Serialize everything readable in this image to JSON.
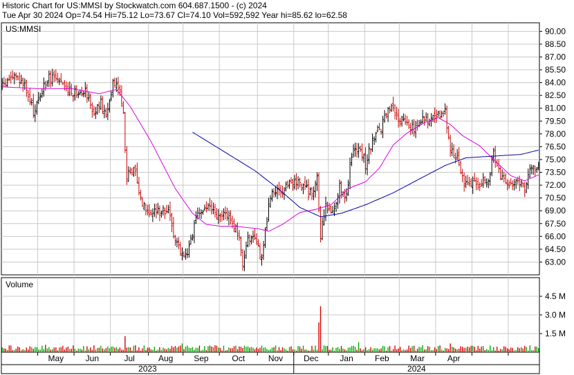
{
  "header": {
    "line1": "Historic Chart for US:MMSI by Stockwatch.com 604.687.1500 - (c) 2024",
    "line2": "Tue Apr 30 2024   Op=74.54   Hi=75.12   Lo=73.67   Cl=74.10   Vol=592,592   Year hi=85.62   lo=62.58"
  },
  "symbol_label": "US:MMSI",
  "volume_label": "Volume",
  "colors": {
    "background": "#ffffff",
    "grid": "#c8c8c8",
    "bar_up": "#000000",
    "bar_down": "#cc0000",
    "ma_short": "#dd00dd",
    "ma_long": "#0000aa",
    "volume_up": "#00aa00",
    "volume_down": "#dd0000"
  },
  "chart_data": [
    {
      "type": "ohlc",
      "title": "US:MMSI",
      "y_ticks": [
        "90.00",
        "88.50",
        "87.00",
        "85.50",
        "84.00",
        "82.50",
        "81.00",
        "79.50",
        "78.00",
        "76.50",
        "75.00",
        "73.50",
        "72.00",
        "70.50",
        "69.00",
        "67.50",
        "66.00",
        "64.50",
        "63.00"
      ],
      "ylim": [
        61.5,
        91.0
      ],
      "x_month_labels": [
        "May",
        "Jun",
        "Jul",
        "Aug",
        "Sep",
        "Oct",
        "Nov",
        "Dec",
        "Jan",
        "Feb",
        "Mar",
        "Apr"
      ],
      "x_year_labels": [
        "2023",
        "2024"
      ],
      "grid": true,
      "price_anchors": [
        {
          "d": 0,
          "c": 83.5
        },
        {
          "d": 6,
          "c": 84.8
        },
        {
          "d": 13,
          "c": 83.6
        },
        {
          "d": 18,
          "c": 80.5
        },
        {
          "d": 24,
          "c": 83.6
        },
        {
          "d": 29,
          "c": 84.9
        },
        {
          "d": 35,
          "c": 83.4
        },
        {
          "d": 42,
          "c": 82.9
        },
        {
          "d": 48,
          "c": 83.3
        },
        {
          "d": 53,
          "c": 80.4
        },
        {
          "d": 57,
          "c": 81.5
        },
        {
          "d": 60,
          "c": 79.8
        },
        {
          "d": 64,
          "c": 84.3
        },
        {
          "d": 68,
          "c": 83.4
        },
        {
          "d": 70,
          "c": 80.2
        },
        {
          "d": 72,
          "c": 72.8
        },
        {
          "d": 76,
          "c": 74.4
        },
        {
          "d": 80,
          "c": 70.4
        },
        {
          "d": 86,
          "c": 68.6
        },
        {
          "d": 93,
          "c": 69.3
        },
        {
          "d": 96,
          "c": 68.7
        },
        {
          "d": 101,
          "c": 65.1
        },
        {
          "d": 106,
          "c": 63.6
        },
        {
          "d": 109,
          "c": 65.9
        },
        {
          "d": 114,
          "c": 68.8
        },
        {
          "d": 119,
          "c": 69.6
        },
        {
          "d": 125,
          "c": 68.0
        },
        {
          "d": 130,
          "c": 68.8
        },
        {
          "d": 136,
          "c": 66.4
        },
        {
          "d": 139,
          "c": 63.1
        },
        {
          "d": 142,
          "c": 65.9
        },
        {
          "d": 147,
          "c": 65.1
        },
        {
          "d": 150,
          "c": 63.5
        },
        {
          "d": 152,
          "c": 66.9
        },
        {
          "d": 156,
          "c": 71.7
        },
        {
          "d": 162,
          "c": 70.5
        },
        {
          "d": 166,
          "c": 72.6
        },
        {
          "d": 172,
          "c": 72.3
        },
        {
          "d": 178,
          "c": 71.0
        },
        {
          "d": 182,
          "c": 72.5
        },
        {
          "d": 184,
          "c": 66.0
        },
        {
          "d": 187,
          "c": 69.5
        },
        {
          "d": 191,
          "c": 68.7
        },
        {
          "d": 195,
          "c": 71.9
        },
        {
          "d": 199,
          "c": 70.8
        },
        {
          "d": 202,
          "c": 75.6
        },
        {
          "d": 206,
          "c": 76.5
        },
        {
          "d": 210,
          "c": 74.5
        },
        {
          "d": 215,
          "c": 77.8
        },
        {
          "d": 219,
          "c": 78.8
        },
        {
          "d": 224,
          "c": 81.0
        },
        {
          "d": 229,
          "c": 79.8
        },
        {
          "d": 234,
          "c": 79.2
        },
        {
          "d": 239,
          "c": 78.7
        },
        {
          "d": 244,
          "c": 79.9
        },
        {
          "d": 248,
          "c": 79.6
        },
        {
          "d": 252,
          "c": 80.2
        },
        {
          "d": 256,
          "c": 80.4
        },
        {
          "d": 259,
          "c": 76.6
        },
        {
          "d": 263,
          "c": 75.3
        },
        {
          "d": 267,
          "c": 72.4
        },
        {
          "d": 271,
          "c": 72.0
        },
        {
          "d": 276,
          "c": 72.4
        },
        {
          "d": 281,
          "c": 72.2
        },
        {
          "d": 284,
          "c": 75.9
        },
        {
          "d": 288,
          "c": 73.0
        },
        {
          "d": 293,
          "c": 72.3
        },
        {
          "d": 298,
          "c": 72.5
        },
        {
          "d": 302,
          "c": 71.6
        },
        {
          "d": 305,
          "c": 73.3
        },
        {
          "d": 308,
          "c": 74.1
        },
        {
          "d": 310,
          "c": 74.1
        }
      ],
      "ma_short_anchors": [
        {
          "d": 0,
          "v": 83.5
        },
        {
          "d": 20,
          "v": 83.3
        },
        {
          "d": 40,
          "v": 83.3
        },
        {
          "d": 56,
          "v": 82.7
        },
        {
          "d": 66,
          "v": 83.2
        },
        {
          "d": 74,
          "v": 81.2
        },
        {
          "d": 86,
          "v": 77.1
        },
        {
          "d": 100,
          "v": 71.6
        },
        {
          "d": 110,
          "v": 68.7
        },
        {
          "d": 118,
          "v": 67.4
        },
        {
          "d": 126,
          "v": 67.2
        },
        {
          "d": 134,
          "v": 67.2
        },
        {
          "d": 148,
          "v": 66.9
        },
        {
          "d": 154,
          "v": 66.6
        },
        {
          "d": 162,
          "v": 67.4
        },
        {
          "d": 172,
          "v": 68.8
        },
        {
          "d": 182,
          "v": 69.2
        },
        {
          "d": 190,
          "v": 69.7
        },
        {
          "d": 200,
          "v": 71.6
        },
        {
          "d": 210,
          "v": 72.4
        },
        {
          "d": 218,
          "v": 74.0
        },
        {
          "d": 226,
          "v": 76.7
        },
        {
          "d": 234,
          "v": 78.1
        },
        {
          "d": 244,
          "v": 79.3
        },
        {
          "d": 252,
          "v": 79.9
        },
        {
          "d": 259,
          "v": 79.1
        },
        {
          "d": 266,
          "v": 77.8
        },
        {
          "d": 276,
          "v": 76.6
        },
        {
          "d": 284,
          "v": 75.0
        },
        {
          "d": 294,
          "v": 73.1
        },
        {
          "d": 302,
          "v": 72.5
        },
        {
          "d": 310,
          "v": 73.2
        }
      ],
      "ma_long_anchors": [
        {
          "d": 110,
          "v": 78.2
        },
        {
          "d": 126,
          "v": 76.2
        },
        {
          "d": 146,
          "v": 73.7
        },
        {
          "d": 160,
          "v": 71.5
        },
        {
          "d": 172,
          "v": 69.4
        },
        {
          "d": 184,
          "v": 68.3
        },
        {
          "d": 196,
          "v": 68.7
        },
        {
          "d": 210,
          "v": 69.7
        },
        {
          "d": 226,
          "v": 71.1
        },
        {
          "d": 240,
          "v": 72.6
        },
        {
          "d": 256,
          "v": 74.3
        },
        {
          "d": 268,
          "v": 75.2
        },
        {
          "d": 284,
          "v": 75.4
        },
        {
          "d": 300,
          "v": 75.6
        },
        {
          "d": 310,
          "v": 76.1
        }
      ]
    },
    {
      "type": "bar",
      "title": "Volume",
      "y_ticks": [
        "4.5 M",
        "3.0 M",
        "1.5 M"
      ],
      "ylim": [
        0,
        6.0
      ],
      "unit": "M shares",
      "volume_spikes": [
        {
          "d": 184,
          "v": 3.7
        },
        {
          "d": 183,
          "v": 2.4
        },
        {
          "d": 71,
          "v": 1.3
        },
        {
          "d": 206,
          "v": 0.8
        },
        {
          "d": 104,
          "v": 0.7
        },
        {
          "d": 25,
          "v": 0.6
        },
        {
          "d": 259,
          "v": 0.7
        }
      ],
      "typical_volume": 0.4
    }
  ]
}
